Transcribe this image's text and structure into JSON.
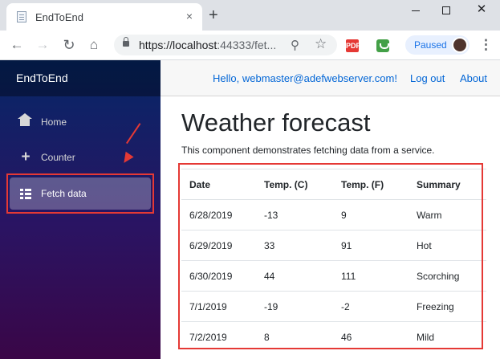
{
  "browser": {
    "tab_title": "EndToEnd",
    "tab_close": "×",
    "new_tab": "+",
    "win_close": "✕",
    "url_host": "https://localhost",
    "url_rest": ":44333/fet...",
    "profile_status": "Paused",
    "ext_pdf": "PDF",
    "menu": "⋮"
  },
  "app": {
    "brand": "EndToEnd",
    "topbar": {
      "hello": "Hello, webmaster@adefwebserver.com!",
      "logout": "Log out",
      "about": "About"
    },
    "nav": [
      {
        "label": "Home",
        "icon": "home-icon"
      },
      {
        "label": "Counter",
        "icon": "plus-icon"
      },
      {
        "label": "Fetch data",
        "icon": "list-icon",
        "active": true
      }
    ]
  },
  "page": {
    "title": "Weather forecast",
    "description": "This component demonstrates fetching data from a service.",
    "table": {
      "headers": [
        "Date",
        "Temp. (C)",
        "Temp. (F)",
        "Summary"
      ],
      "rows": [
        [
          "6/28/2019",
          "-13",
          "9",
          "Warm"
        ],
        [
          "6/29/2019",
          "33",
          "91",
          "Hot"
        ],
        [
          "6/30/2019",
          "44",
          "111",
          "Scorching"
        ],
        [
          "7/1/2019",
          "-19",
          "-2",
          "Freezing"
        ],
        [
          "7/2/2019",
          "8",
          "46",
          "Mild"
        ]
      ]
    }
  },
  "colors": {
    "annotation": "#e53935",
    "link": "#0366d6",
    "sidebar_top": "#052767",
    "sidebar_bottom": "#3a0647"
  }
}
